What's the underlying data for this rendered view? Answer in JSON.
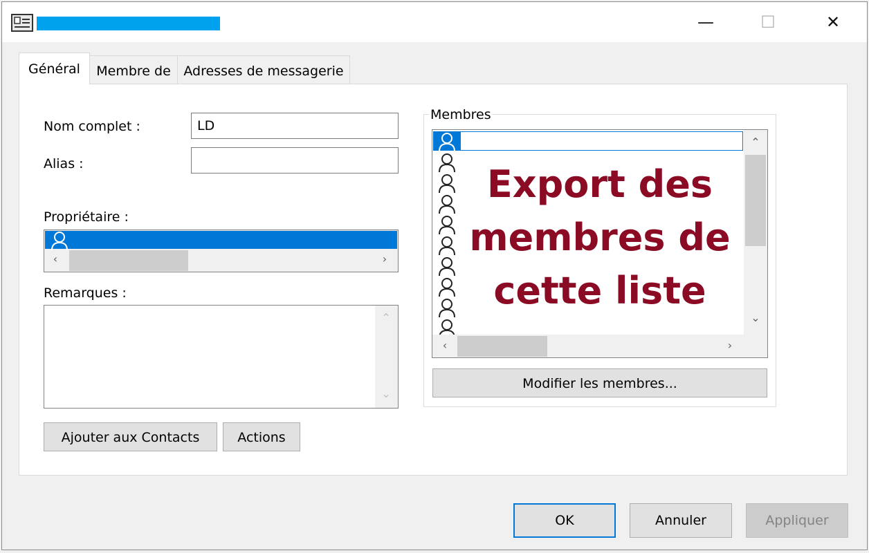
{
  "window": {
    "controls": {
      "minimize": "—",
      "maximize": "☐",
      "close": "✕"
    }
  },
  "tabs": [
    {
      "label": "Général"
    },
    {
      "label": "Membre de"
    },
    {
      "label": "Adresses de messagerie"
    }
  ],
  "general": {
    "full_name_label": "Nom complet :",
    "full_name_value": "LD",
    "alias_label": "Alias :",
    "owner_label": "Propriétaire :",
    "notes_label": "Remarques :",
    "add_contacts_label": "Ajouter aux Contacts",
    "actions_label": "Actions"
  },
  "members": {
    "group_label": "Membres",
    "overlay_line1": "Export des",
    "overlay_line2": "membres de",
    "overlay_line3": "cette liste",
    "modify_label": "Modifier les membres..."
  },
  "footer": {
    "ok_label": "OK",
    "cancel_label": "Annuler",
    "apply_label": "Appliquer"
  },
  "colors": {
    "accent": "#0078d7",
    "redaction": "#00a2ed",
    "overlay_text": "#8b0a24"
  }
}
